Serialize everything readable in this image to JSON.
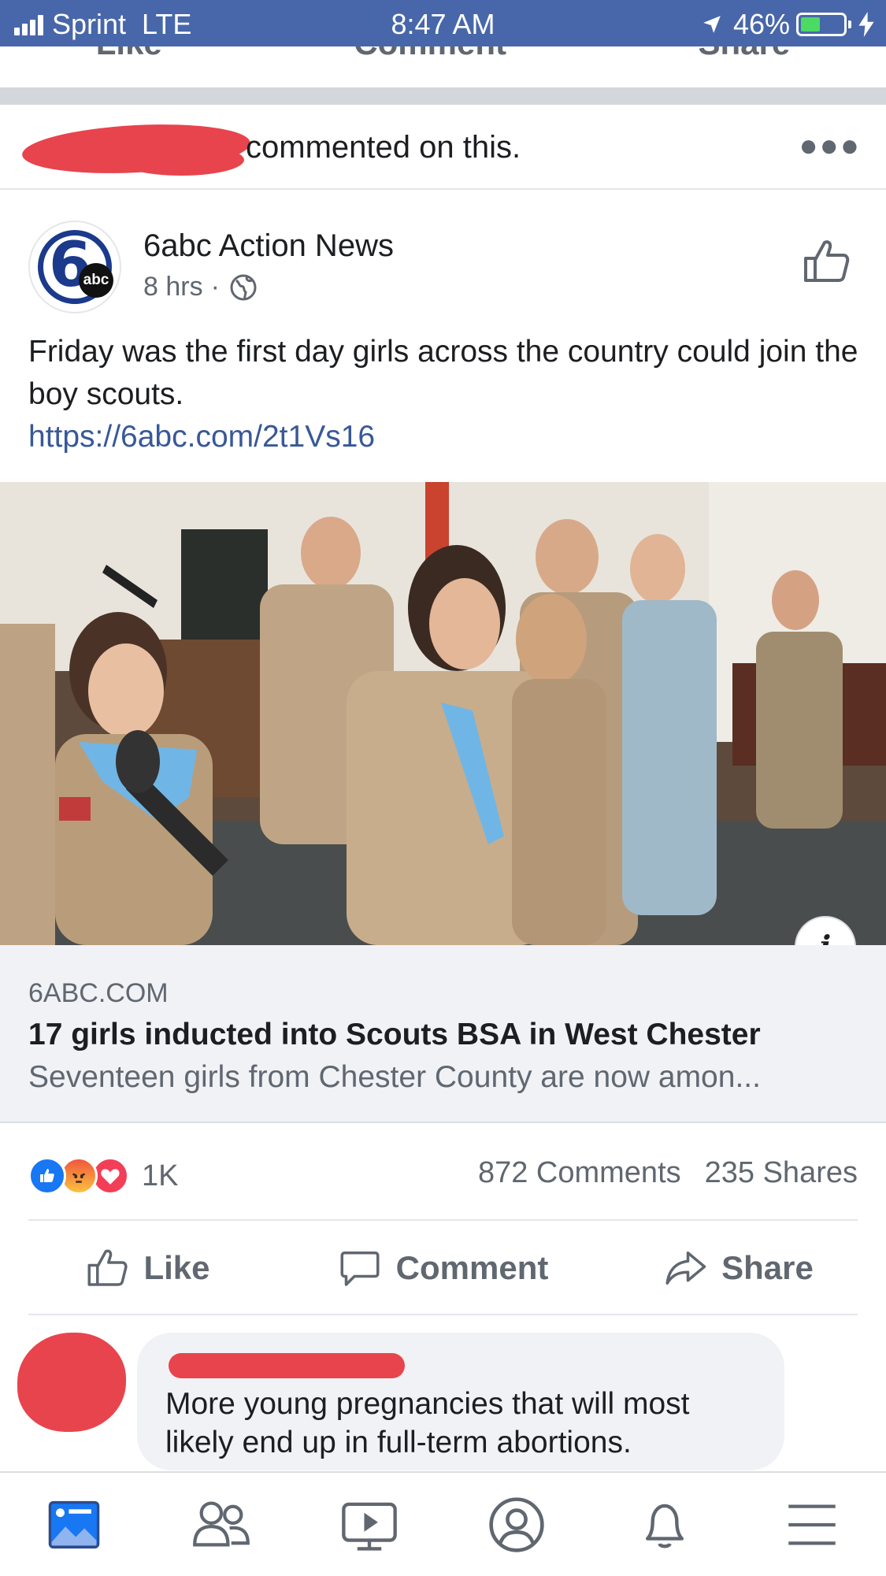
{
  "status_bar": {
    "carrier": "Sprint",
    "network": "LTE",
    "time": "8:47 AM",
    "battery": "46%",
    "battery_level": 0.46
  },
  "previous_post_actions": {
    "like": "Like",
    "comment": "Comment",
    "share": "Share"
  },
  "activity": {
    "text": "commented on this."
  },
  "post": {
    "page_name": "6abc Action News",
    "time": "8 hrs",
    "separator": "·",
    "avatar_text": "6",
    "avatar_badge": "abc",
    "text": "Friday was the first day girls across the country could join the boy scouts.",
    "link": "https://6abc.com/2t1Vs16"
  },
  "link_preview": {
    "domain": "6ABC.COM",
    "title": "17 girls inducted into Scouts BSA in West Chester",
    "description": "Seventeen girls from Chester County are now amon..."
  },
  "stats": {
    "reactions_count": "1K",
    "comments": "872 Comments",
    "shares": "235 Shares"
  },
  "actions": {
    "like": "Like",
    "comment": "Comment",
    "share": "Share"
  },
  "comment": {
    "text": "More young pregnancies that will most likely end up in full-term abortions."
  },
  "colors": {
    "status_bar": "#4867aa",
    "link": "#385898",
    "redaction": "#e8444d",
    "like_blue": "#1877f2",
    "love_red": "#f33e58"
  }
}
